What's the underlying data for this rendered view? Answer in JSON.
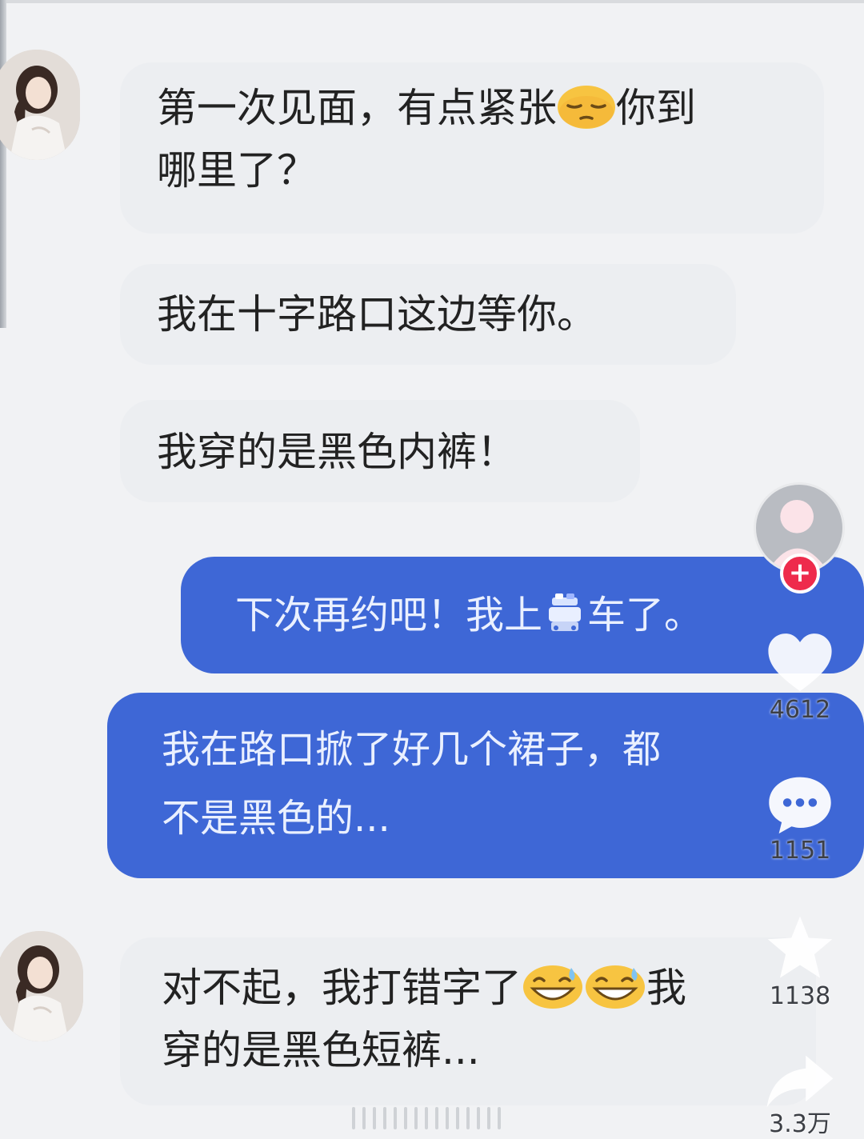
{
  "messages": [
    {
      "side": "received",
      "lines": [
        "第一次见面，有点紧张",
        "你到",
        "哪里了？"
      ],
      "emoji": "relieved-face-icon"
    },
    {
      "side": "received",
      "text": "我在十字路口这边等你。"
    },
    {
      "side": "received",
      "text": "我穿的是黑色内裤！"
    },
    {
      "side": "sent",
      "text_before": "下次再约吧！我上",
      "icon": "police-car-icon",
      "text_after": "车了。"
    },
    {
      "side": "sent",
      "lines": [
        "我在路口掀了好几个裙子，都",
        "不是黑色的..."
      ]
    },
    {
      "side": "received",
      "lines": [
        "对不起，我打错字了",
        "我",
        "穿的是黑色短裤..."
      ],
      "emoji": "grinning-sweat-face-icon"
    }
  ],
  "rail": {
    "likes": "4612",
    "comments": "1151",
    "favorites": "1138",
    "shares": "3.3万",
    "follow_symbol": "+"
  },
  "colors": {
    "background": "#f1f2f4",
    "received_bubble": "#eceef1",
    "sent_bubble": "#3e67d6",
    "follow_button": "#ee2b4c"
  }
}
